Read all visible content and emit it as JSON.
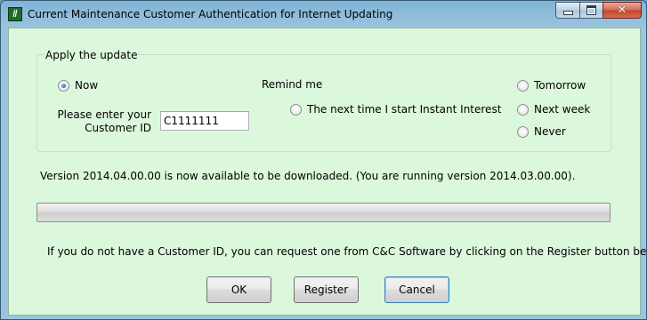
{
  "window": {
    "title": "Current Maintenance Customer Authentication for Internet Updating",
    "icon": "app-logo-icon",
    "controls": {
      "minimize": "minimize-icon",
      "maximize": "maximize-icon",
      "close": "close-icon"
    }
  },
  "group": {
    "label": "Apply the update",
    "now_label": "Now",
    "now_selected": true,
    "customer_id_label_line1": "Please enter your",
    "customer_id_label_line2": "Customer ID",
    "customer_id_value": "C1111111",
    "remind_label": "Remind me",
    "remind_options": [
      {
        "label": "The next time I start Instant Interest",
        "selected": false
      },
      {
        "label": "Tomorrow",
        "selected": false
      },
      {
        "label": "Next week",
        "selected": false
      },
      {
        "label": "Never",
        "selected": false
      }
    ]
  },
  "version_text": "Version 2014.04.00.00 is now available to be downloaded. (You are running version 2014.03.00.00).",
  "progress": {
    "value": 0
  },
  "register_info": "If you do not have a Customer ID, you can request one from C&C Software by clicking on the Register button below.",
  "buttons": {
    "ok": "OK",
    "register": "Register",
    "cancel": "Cancel"
  },
  "colors": {
    "client_bg": "#dcf8dc",
    "title_bar": "#9bc4df",
    "close_button": "#c2442c"
  }
}
